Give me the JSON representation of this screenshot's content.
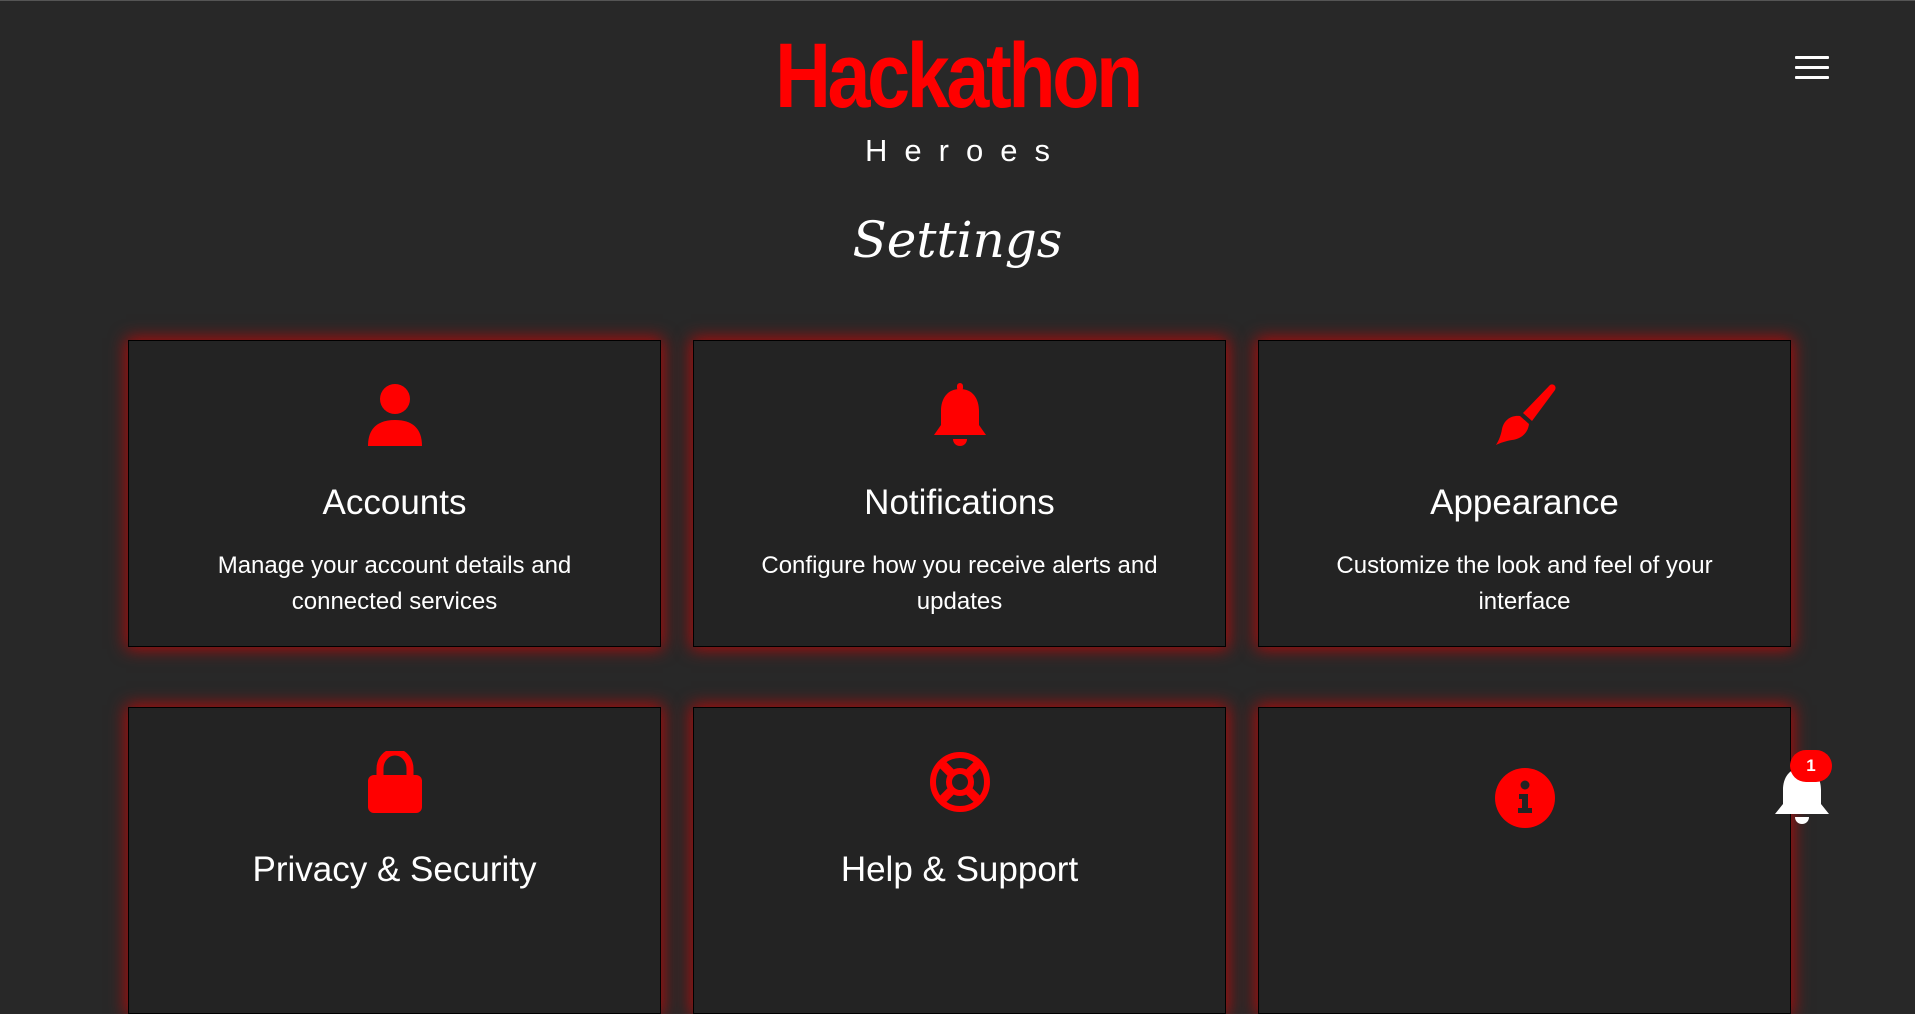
{
  "header": {
    "logo_title": "Hackathon",
    "logo_subtitle": "Heroes",
    "menu_icon": "hamburger-menu-icon"
  },
  "page": {
    "title": "Settings"
  },
  "cards": [
    {
      "title": "Accounts",
      "description": "Manage your account details and connected services",
      "icon": "user-icon"
    },
    {
      "title": "Notifications",
      "description": "Configure how you receive alerts and updates",
      "icon": "bell-icon"
    },
    {
      "title": "Appearance",
      "description": "Customize the look and feel of your interface",
      "icon": "paintbrush-icon"
    },
    {
      "title": "Privacy & Security",
      "description": "",
      "icon": "lock-icon"
    },
    {
      "title": "Help & Support",
      "description": "",
      "icon": "lifebuoy-icon"
    },
    {
      "title": "",
      "description": "",
      "icon": "info-circle-icon"
    }
  ],
  "notification_fab": {
    "icon": "bell-icon",
    "badge_count": "1"
  },
  "colors": {
    "background": "#282828",
    "card_background": "#232323",
    "accent": "#ff0000",
    "text": "#ffffff"
  }
}
